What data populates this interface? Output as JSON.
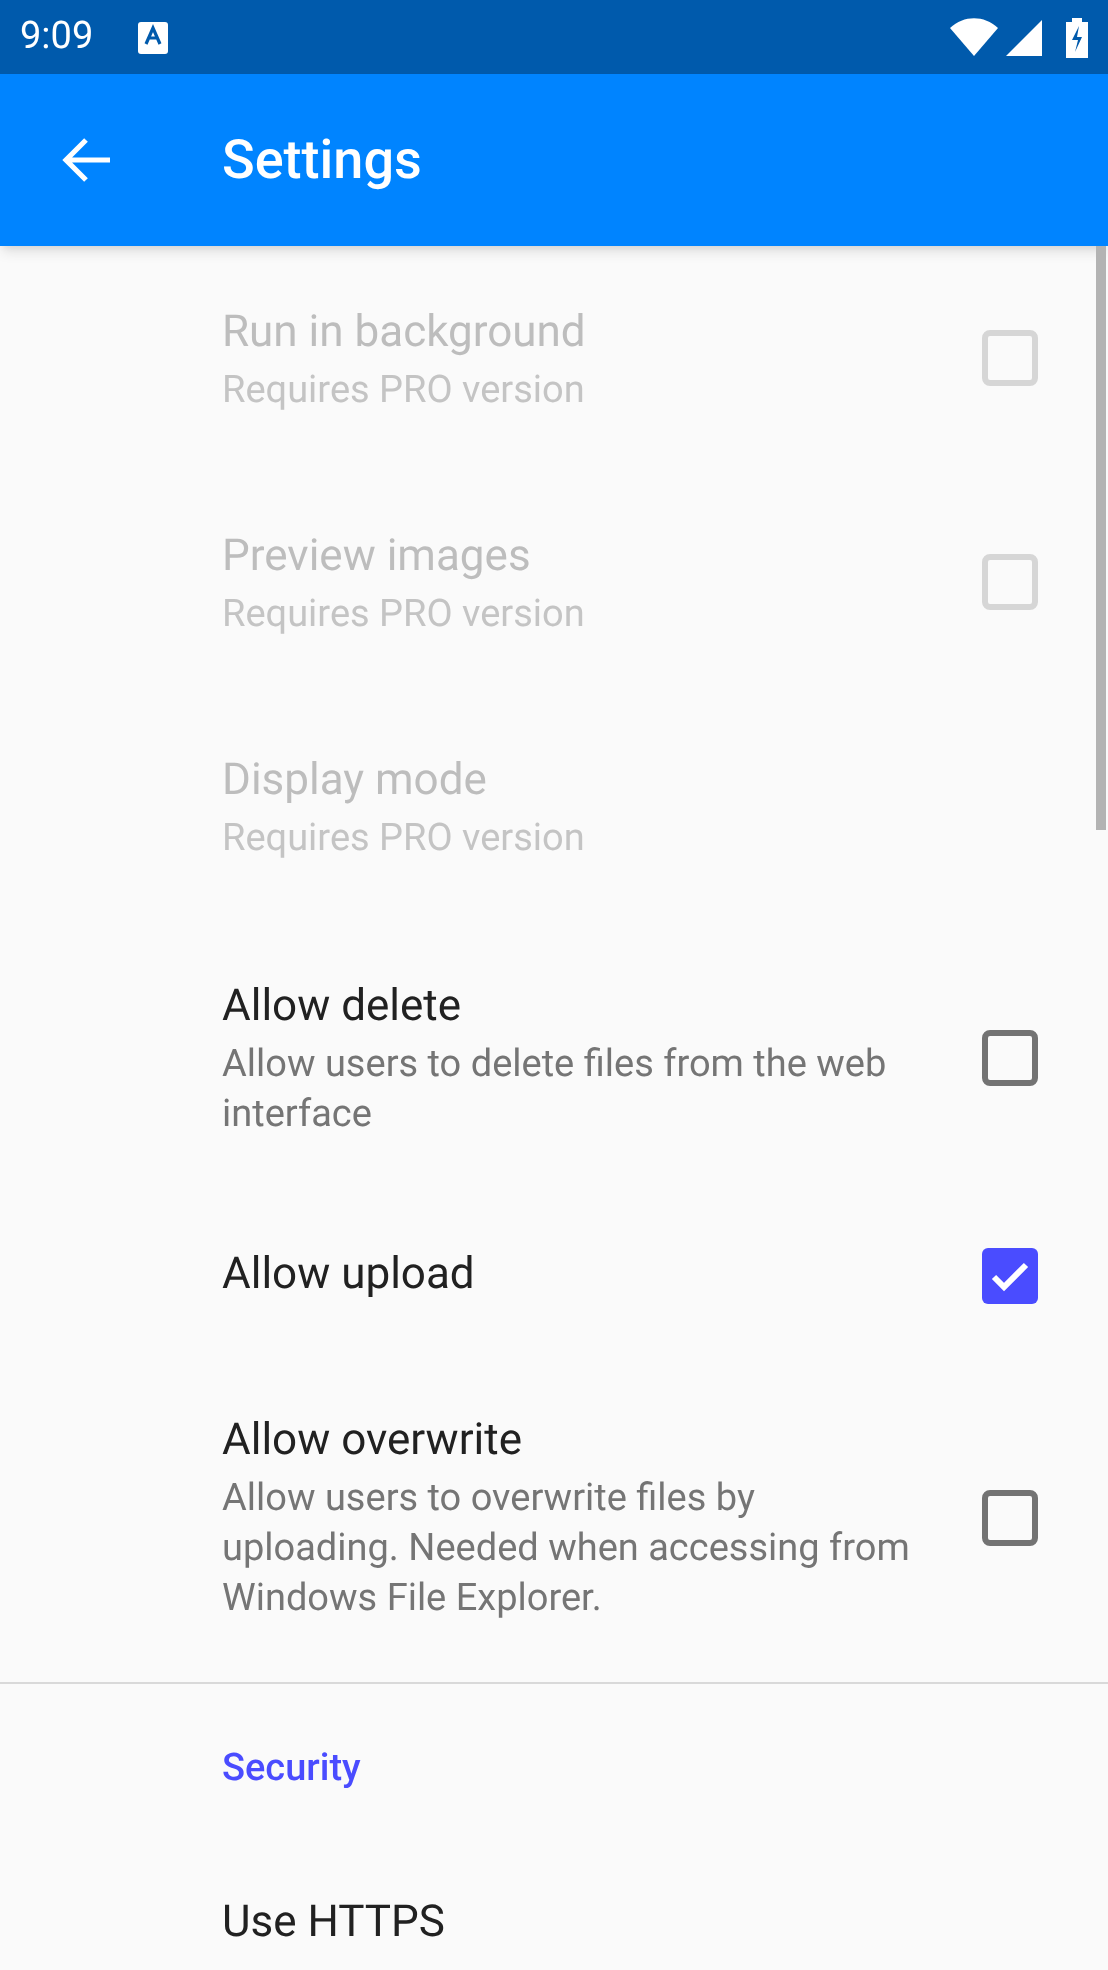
{
  "status_bar": {
    "time": "9:09"
  },
  "app_bar": {
    "title": "Settings"
  },
  "preferences": [
    {
      "kind": "checkbox",
      "title": "Run in background",
      "summary": "Requires PRO version",
      "disabled": true,
      "checked": false
    },
    {
      "kind": "checkbox",
      "title": "Preview images",
      "summary": "Requires PRO version",
      "disabled": true,
      "checked": false
    },
    {
      "kind": "plain",
      "title": "Display mode",
      "summary": "Requires PRO version",
      "disabled": true
    },
    {
      "kind": "checkbox",
      "title": "Allow delete",
      "summary": "Allow users to delete files from the web interface",
      "disabled": false,
      "checked": false
    },
    {
      "kind": "checkbox",
      "title": "Allow upload",
      "disabled": false,
      "checked": true
    },
    {
      "kind": "checkbox",
      "title": "Allow overwrite",
      "summary": "Allow users to overwrite files by uploading. Needed when accessing from Windows File Explorer.",
      "disabled": false,
      "checked": false
    }
  ],
  "section": {
    "title": "Security",
    "preferences": [
      {
        "title": "Use HTTPS"
      }
    ]
  }
}
